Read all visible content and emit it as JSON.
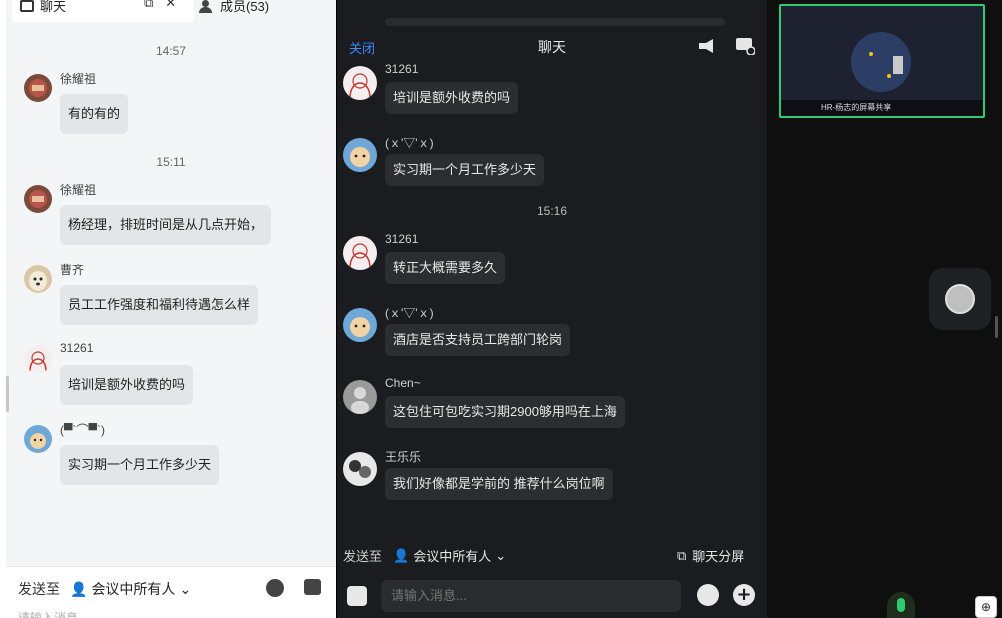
{
  "left_panel": {
    "tabs": {
      "chat": "聊天",
      "members": "成员(53)"
    },
    "messages": [
      {
        "type": "time",
        "text": "14:57"
      },
      {
        "type": "msg",
        "name": "徐耀祖",
        "text": "有的有的",
        "avatar": "avatar-red-stamp"
      },
      {
        "type": "time",
        "text": "15:11"
      },
      {
        "type": "msg",
        "name": "徐耀祖",
        "text": "杨经理，排班时间是从几点开始，",
        "avatar": "avatar-red-stamp"
      },
      {
        "type": "msg",
        "name": "曹齐",
        "text": "员工工作强度和福利待遇怎么样",
        "avatar": "avatar-dog"
      },
      {
        "type": "msg",
        "name": "31261",
        "text": "培训是额外收费的吗",
        "avatar": "avatar-sketch-girl"
      },
      {
        "type": "msg",
        "name": "(▀`⌒▀`)",
        "text": "实习期一个月工作多少天",
        "avatar": "avatar-cartoon-cat"
      }
    ],
    "footer": {
      "send_to_label": "发送至",
      "target": "会议中所有人",
      "placeholder": "请输入消息..."
    }
  },
  "middle_panel": {
    "close_label": "关闭",
    "title": "聊天",
    "messages": [
      {
        "type": "msg",
        "name": "31261",
        "text": "培训是额外收费的吗",
        "avatar": "avatar-sketch-girl"
      },
      {
        "type": "msg",
        "name": "(ｘ'▽'ｘ)",
        "text": "实习期一个月工作多少天",
        "avatar": "avatar-cartoon-cat"
      },
      {
        "type": "time",
        "text": "15:16"
      },
      {
        "type": "msg",
        "name": "31261",
        "text": "转正大概需要多久",
        "avatar": "avatar-sketch-girl"
      },
      {
        "type": "msg",
        "name": "(ｘ'▽'ｘ)",
        "text": "酒店是否支持员工跨部门轮岗",
        "avatar": "avatar-cartoon-cat"
      },
      {
        "type": "msg",
        "name": "Chen~",
        "text": "这包住可包吃实习期2900够用吗在上海",
        "avatar": "avatar-person"
      },
      {
        "type": "msg",
        "name": "王乐乐",
        "text": "我们好像都是学前的 推荐什么岗位啊",
        "avatar": "avatar-bw"
      }
    ],
    "send_to_label": "发送至",
    "send_target": "会议中所有人",
    "split_label": "聊天分屏",
    "input_placeholder": "请输入消息..."
  },
  "right_panel": {
    "video_label": "HR-杨志的屏幕共享",
    "zoom_icon": "⊕"
  },
  "colors": {
    "accent_blue": "#3d8bff",
    "active_green": "#2ecc71",
    "dark_bg": "#1b1c1f"
  }
}
